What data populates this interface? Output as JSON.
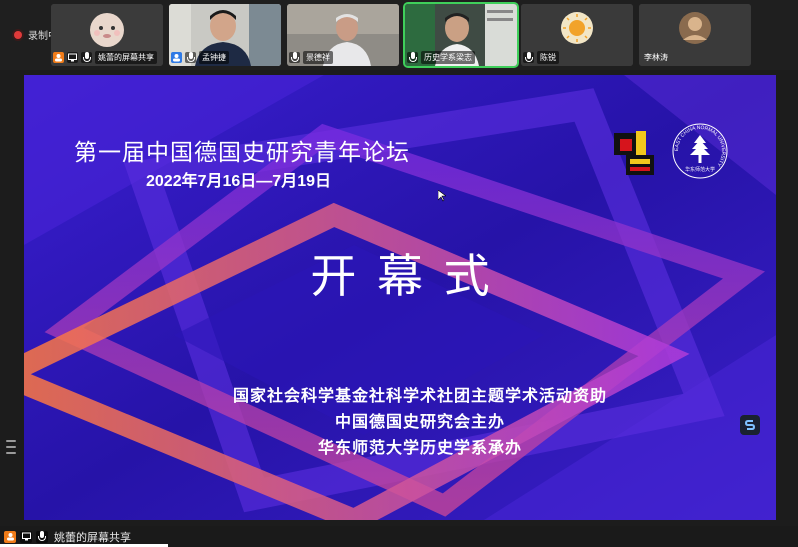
{
  "recording": {
    "label": "录制中"
  },
  "participants": [
    {
      "name": "姚蕾的屏幕共享",
      "icons": [
        "screen-share-icon",
        "mic-muted-icon"
      ]
    },
    {
      "name": "孟钟捷",
      "icons": [
        "person-icon",
        "mic-icon"
      ]
    },
    {
      "name": "景德祥",
      "icons": [
        "mic-muted-icon"
      ]
    },
    {
      "name": "历史学系梁志",
      "icons": [
        "mic-icon"
      ]
    },
    {
      "name": "陈锐",
      "icons": [
        "mic-muted-icon"
      ]
    },
    {
      "name": "李林涛",
      "icons": []
    }
  ],
  "slide": {
    "title": "第一届中国德国史研究青年论坛",
    "dates": "2022年7月16日—7月19日",
    "heading": "开  幕  式",
    "lines": [
      "国家社会科学基金社科学术社团主题学术活动资助",
      "中国德国史研究会主办",
      "华东师范大学历史学系承办"
    ],
    "logo_ring_text": "EAST CHINA NORMAL UNIVERSITY",
    "logo_seal_text": "华东师范大学"
  },
  "share_bar": {
    "label": "姚蕾的屏幕共享"
  },
  "colors": {
    "slide_bg": "#2a1bb0",
    "accent_orange": "#f07c19",
    "accent_blue": "#2f7ae5",
    "recording_red": "#e03a3a"
  }
}
